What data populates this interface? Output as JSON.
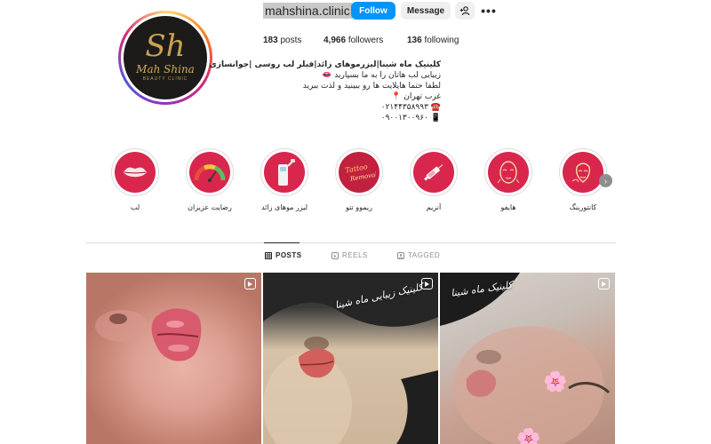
{
  "profile": {
    "username": "mahshina.clinic",
    "avatar": {
      "monogram": "Sh",
      "brand": "Mah Shina",
      "tagline": "BEAUTY CLINIC"
    },
    "buttons": {
      "follow": "Follow",
      "message": "Message",
      "add_user_icon": "+A",
      "more_icon": "•••"
    },
    "stats": {
      "posts": {
        "value": "183",
        "label": "posts"
      },
      "followers": {
        "value": "4,966",
        "label": "followers"
      },
      "following": {
        "value": "136",
        "label": "following"
      }
    },
    "bio": {
      "name": "کلینیک ماه شینا|لیزرموهای زائد|فیلر لب روسی |جوانسازی",
      "lines": [
        "زیبایی لب هاتان را به ما بسپارید 👄",
        "لطفا حتما هایلایت ها رو ببینید و لذت ببرید",
        "غرب تهران 📍",
        "☎️ ۰۲۱۴۴۳۵۸۹۹۳",
        "📱 ۰۹۰۰۱۳۰۰۹۶۰"
      ]
    }
  },
  "highlights": [
    {
      "label": "لب",
      "icon": "lips-icon"
    },
    {
      "label": "رضایت عزیزان",
      "icon": "satisfaction-gauge-icon"
    },
    {
      "label": "لیزر موهای زائد",
      "icon": "laser-device-icon"
    },
    {
      "label": "ریموو تتو",
      "icon": "tattoo-remove-icon"
    },
    {
      "label": "آنزیم",
      "icon": "syringe-icon"
    },
    {
      "label": "هایفو",
      "icon": "face-hifu-icon"
    },
    {
      "label": "کانتورینگ",
      "icon": "face-contouring-icon"
    }
  ],
  "tabs": [
    {
      "label": "POSTS",
      "icon": "grid-icon",
      "active": true
    },
    {
      "label": "REELS",
      "icon": "reels-icon",
      "active": false
    },
    {
      "label": "TAGGED",
      "icon": "tagged-icon",
      "active": false
    }
  ],
  "posts": [
    {
      "type": "reel",
      "caption": ""
    },
    {
      "type": "reel",
      "caption": "کلینیک زیبایی ماه شینا"
    },
    {
      "type": "reel",
      "caption": "کلینیک ماه شینا"
    }
  ],
  "colors": {
    "accent_blue": "#0095f6",
    "highlight_red": "#d9264d",
    "button_grey": "#efefef",
    "text_secondary": "#737373"
  }
}
